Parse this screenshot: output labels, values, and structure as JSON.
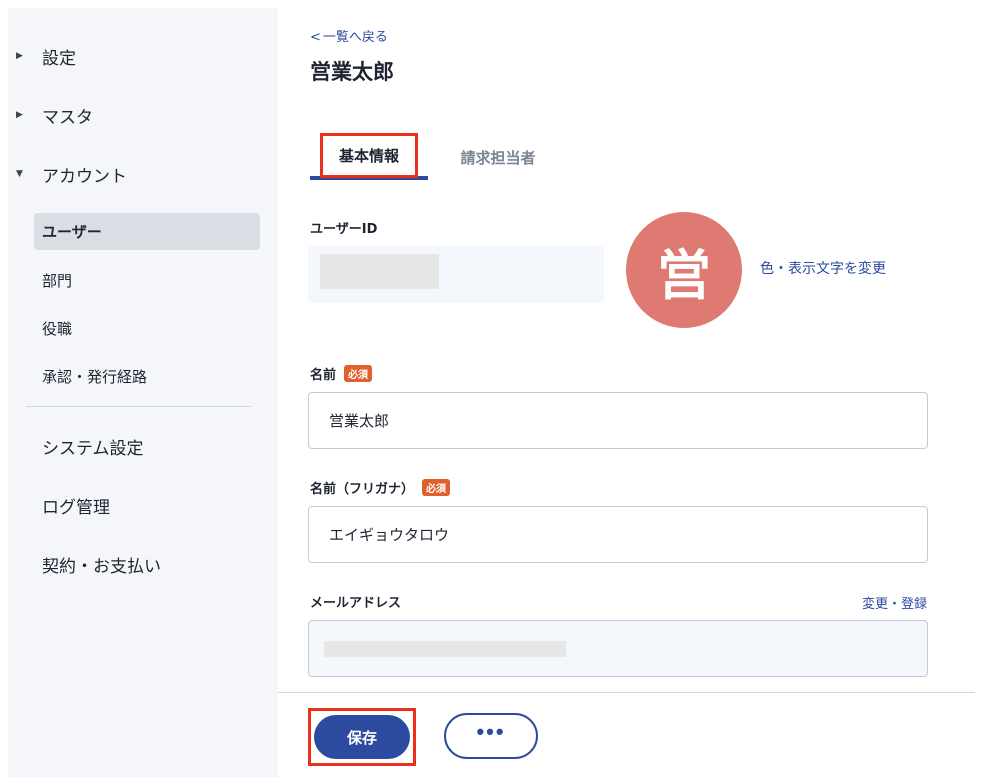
{
  "sidebar": {
    "groups": [
      {
        "icon": "▶",
        "label": "設定"
      },
      {
        "icon": "▶",
        "label": "マスタ"
      },
      {
        "icon": "▼",
        "label": "アカウント"
      }
    ],
    "account_items": [
      "ユーザー",
      "部門",
      "役職",
      "承認・発行経路"
    ],
    "other_items": [
      "システム設定",
      "ログ管理",
      "契約・お支払い"
    ]
  },
  "header": {
    "back_icon": "<",
    "back_label": "一覧へ戻る",
    "title": "営業太郎"
  },
  "tabs": [
    {
      "label": "基本情報",
      "active": true
    },
    {
      "label": "請求担当者",
      "active": false
    }
  ],
  "form": {
    "user_id_label": "ユーザーID",
    "name_label": "名前",
    "name_value": "営業太郎",
    "furigana_label": "名前（フリガナ）",
    "furigana_value": "エイギョウタロウ",
    "email_label": "メールアドレス",
    "required_badge": "必須",
    "change_email_link": "変更・登録"
  },
  "avatar": {
    "initial": "営",
    "color": "#df7a72",
    "change_link": "色・表示文字を変更"
  },
  "footer": {
    "save_label": "保存",
    "more_label": "•••"
  },
  "colors": {
    "accent": "#2b4aa0",
    "highlight": "#e8301a",
    "required": "#e0602e"
  }
}
